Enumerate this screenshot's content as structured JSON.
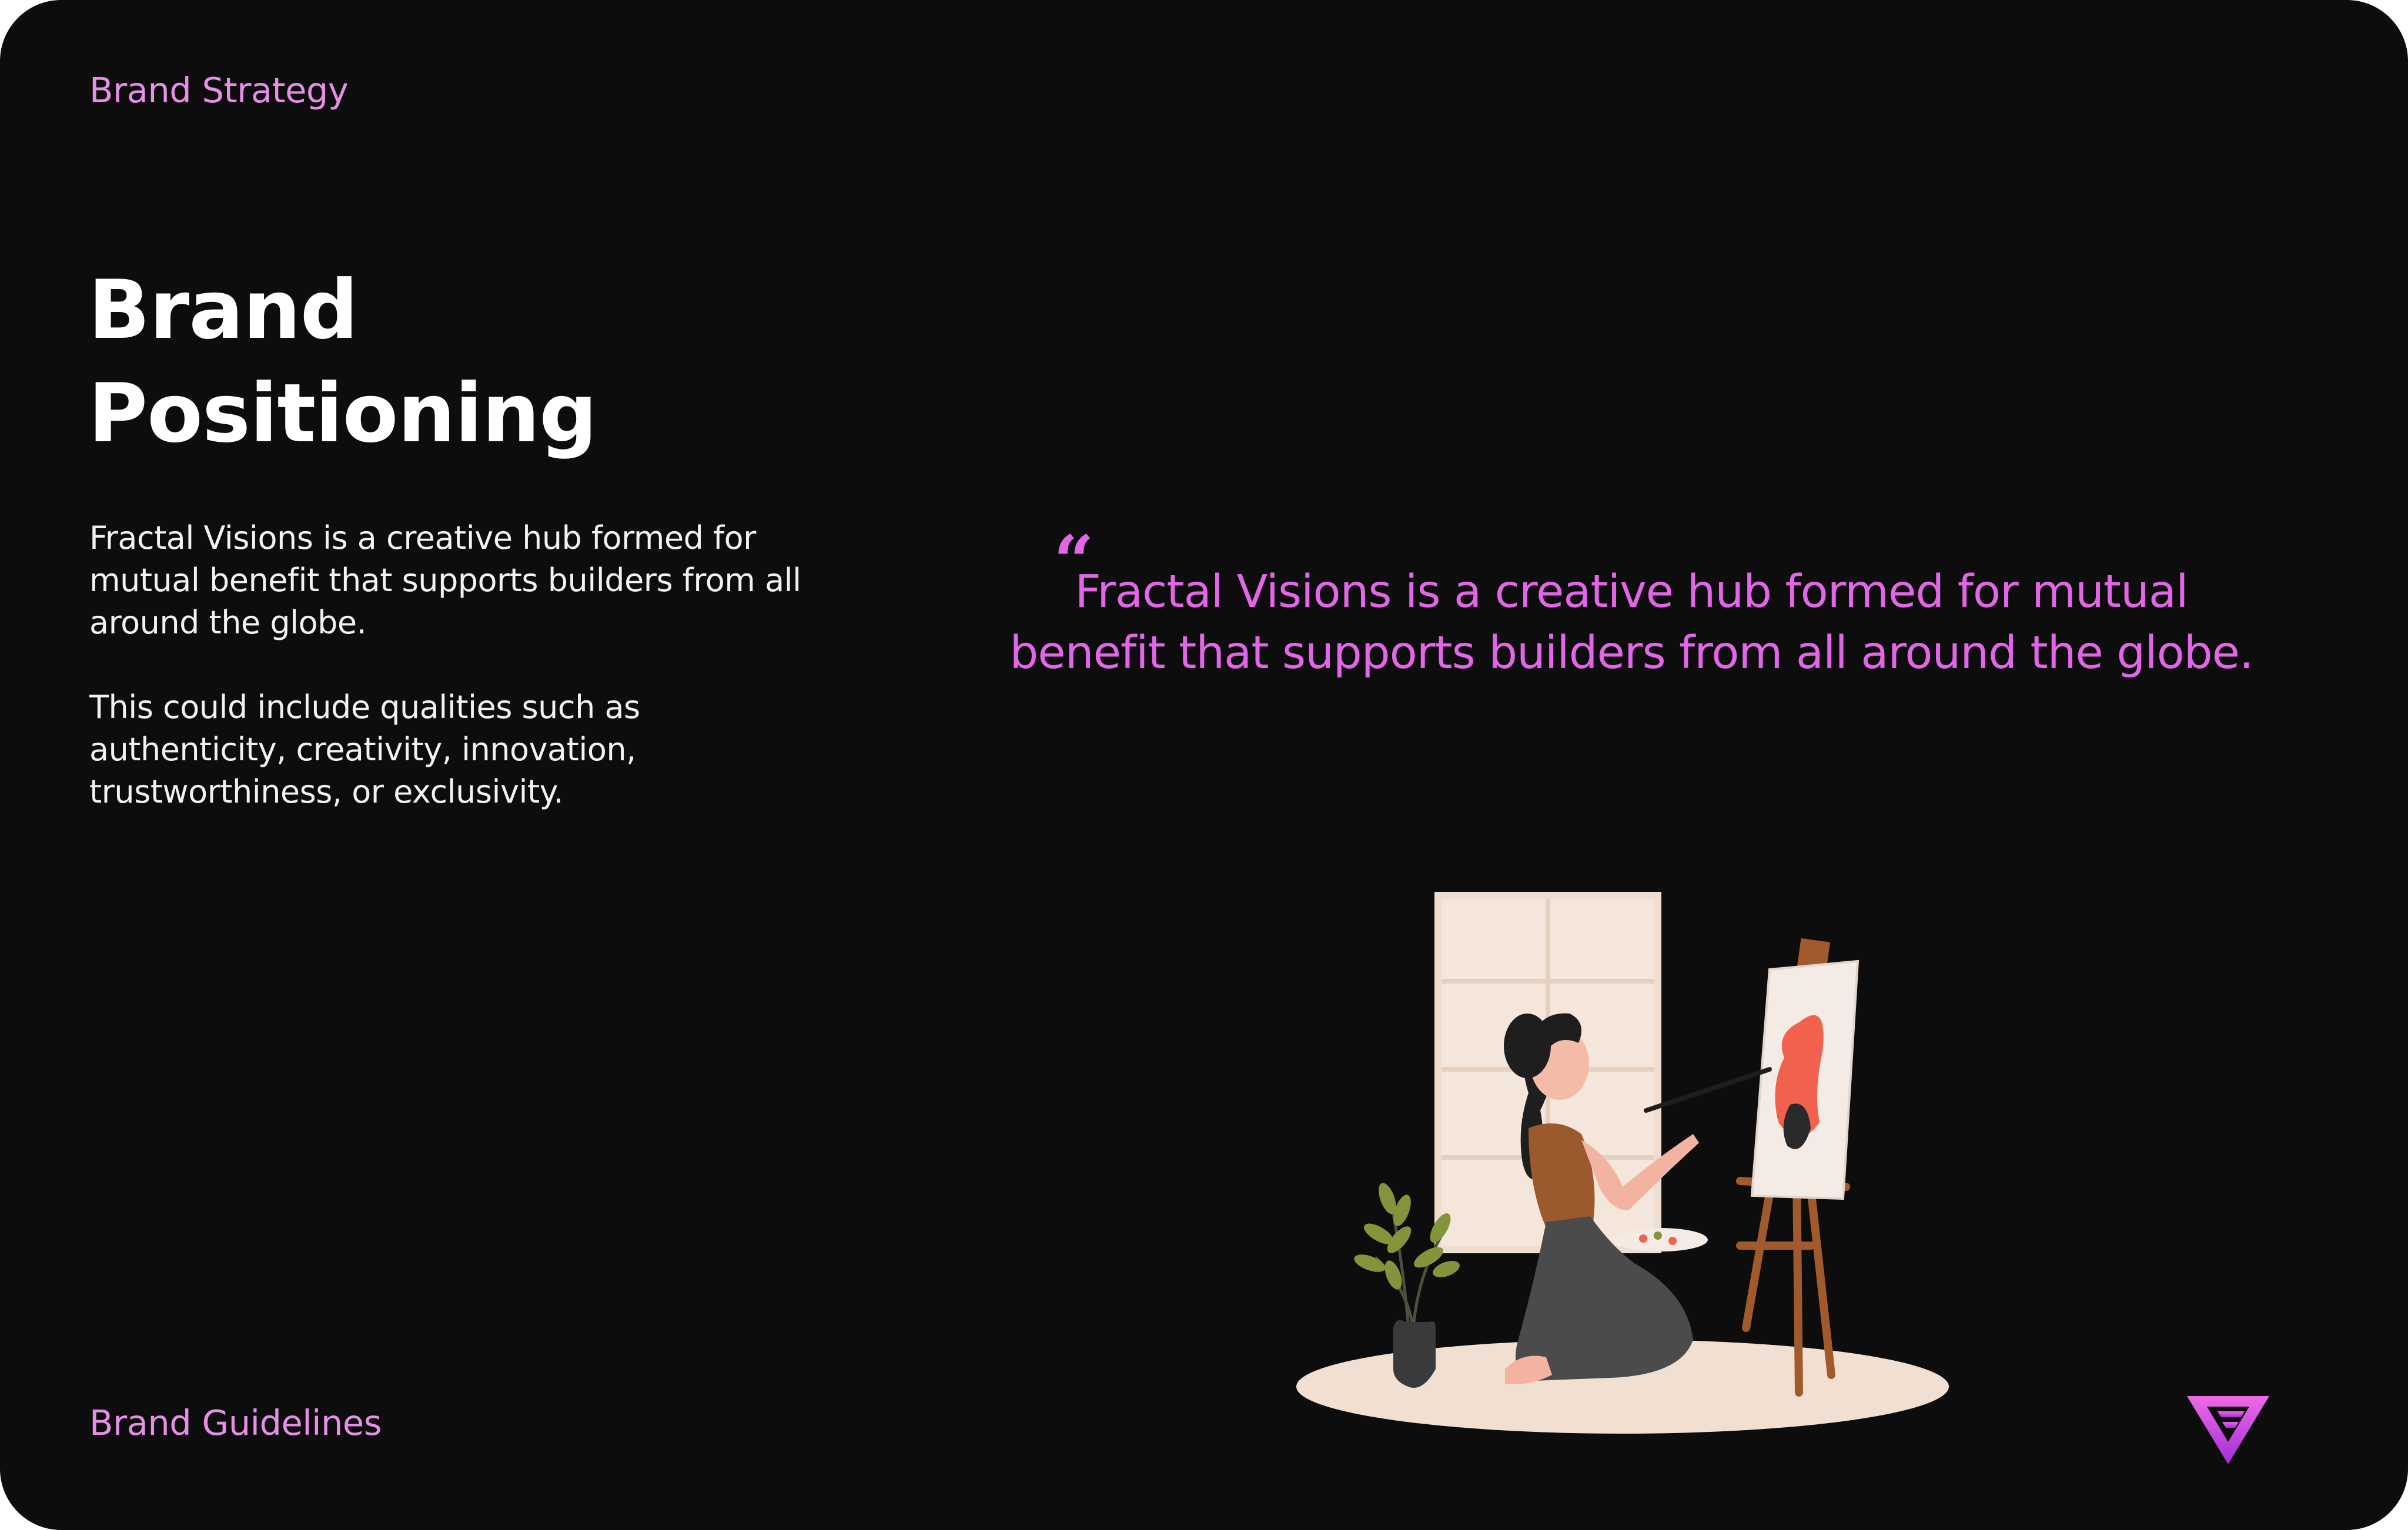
{
  "header": {
    "section_label": "Brand Strategy"
  },
  "title": {
    "line1": "Brand",
    "line2": "Positioning"
  },
  "body": {
    "paragraph1": "Fractal Visions is a creative hub formed for mutual benefit that supports builders from all around the globe.",
    "paragraph2": "This could include qualities such as authenticity, creativity, innovation, trustworthiness, or exclusivity."
  },
  "quote": {
    "mark": "“",
    "text": "Fractal Visions is a creative hub formed for mutual benefit that supports builders from all around the globe."
  },
  "footer": {
    "label": "Brand Guidelines"
  },
  "icons": {
    "illustration": "artist-painting-illustration",
    "logo": "fractal-visions-logo-icon"
  },
  "colors": {
    "background": "#0d0d0d",
    "accent": "#e466e8",
    "label_accent": "#e58fe6",
    "text": "#ffffff"
  }
}
